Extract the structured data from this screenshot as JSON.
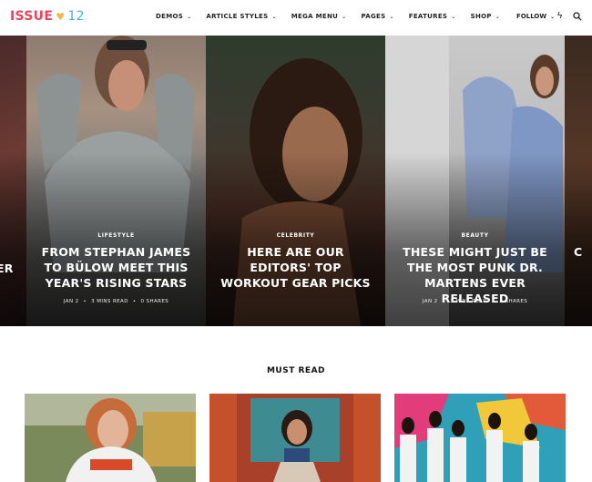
{
  "logo": {
    "part1": "ISSUE",
    "heart": "♥",
    "part2": "12"
  },
  "nav": [
    {
      "label": "DEMOS"
    },
    {
      "label": "ARTICLE STYLES"
    },
    {
      "label": "MEGA MENU"
    },
    {
      "label": "PAGES"
    },
    {
      "label": "FEATURES"
    },
    {
      "label": "SHOP"
    }
  ],
  "header_right": {
    "follow": "FOLLOW",
    "bolt_icon": "lightning-icon",
    "search_icon": "search-icon"
  },
  "slides": [
    {
      "partial_title": "ER"
    },
    {
      "category": "LIFESTYLE",
      "title": "FROM STEPHAN JAMES TO BÜLOW MEET THIS YEAR'S RISING STARS",
      "date": "JAN 2",
      "read": "3 MINS READ",
      "shares": "0 SHARES"
    },
    {
      "category": "CELEBRITY",
      "title": "HERE ARE OUR EDITORS' TOP WORKOUT GEAR PICKS",
      "date": "",
      "read": "",
      "shares": ""
    },
    {
      "category": "BEAUTY",
      "title": "THESE MIGHT JUST BE THE MOST PUNK DR. MARTENS EVER RELEASED",
      "date": "JAN 2",
      "read": "3 MINS READ",
      "shares": "0 SHARES"
    },
    {
      "partial_title": "C"
    }
  ],
  "must_read": {
    "title": "MUST READ"
  }
}
